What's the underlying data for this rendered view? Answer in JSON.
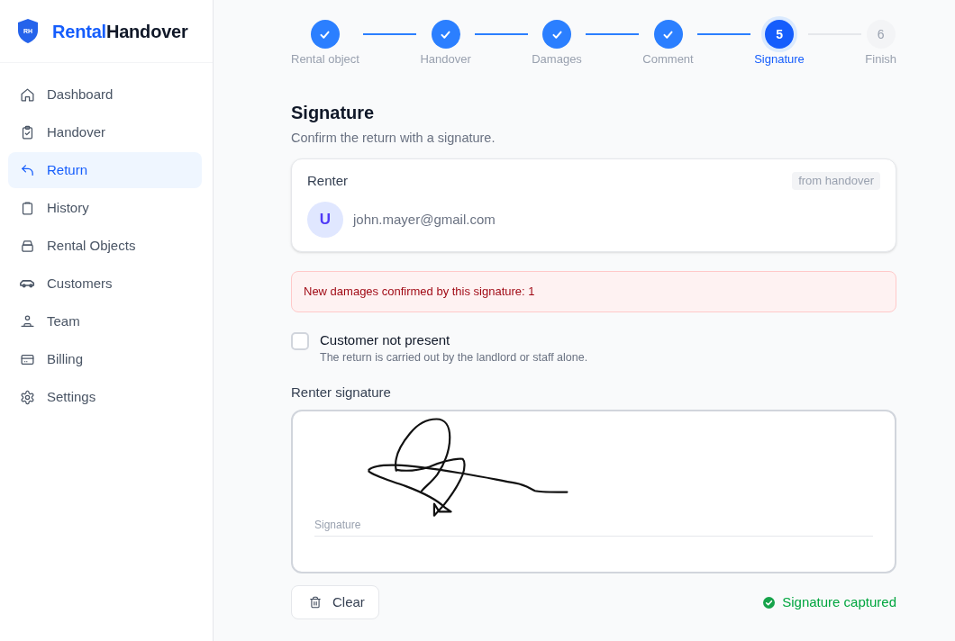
{
  "sidebar": {
    "logo": {
      "initials": "RH",
      "name_accent": "Rental",
      "name_rest": "Handover"
    },
    "items": [
      {
        "label": "Dashboard",
        "selected": false
      },
      {
        "label": "Handover",
        "selected": false
      },
      {
        "label": "Return",
        "selected": true
      },
      {
        "label": "History",
        "selected": false
      },
      {
        "label": "Rental Objects",
        "selected": false
      },
      {
        "label": "Customers",
        "selected": false
      },
      {
        "label": "Team",
        "selected": false
      },
      {
        "label": "Billing",
        "selected": false
      },
      {
        "label": "Settings",
        "selected": false
      }
    ]
  },
  "stepper": {
    "steps": [
      {
        "label": "Rental object",
        "done": true,
        "selected": false
      },
      {
        "label": "Handover",
        "done": true,
        "selected": false
      },
      {
        "label": "Damages",
        "done": true,
        "selected": false
      },
      {
        "label": "Comment",
        "done": true,
        "selected": false
      },
      {
        "label": "Signature",
        "done": false,
        "selected": true,
        "number": "5"
      },
      {
        "label": "Finish",
        "done": false,
        "selected": false,
        "number": "6"
      }
    ]
  },
  "page": {
    "title": "Signature",
    "subtitle": "Confirm the return with a signature."
  },
  "renter_card": {
    "title": "Renter",
    "badge": "from handover",
    "avatar": "U",
    "email": "john.mayer@gmail.com"
  },
  "alert": {
    "text": "New damages confirmed by this signature: 1"
  },
  "customer_not_present": {
    "label": "Customer not present",
    "description": "The return is carried out by the landlord or staff alone.",
    "checked": false
  },
  "signature": {
    "label": "Renter signature",
    "placeholder": "Signature",
    "clear_button": "Clear",
    "status": {
      "text": "Signature captured",
      "captured": true
    }
  }
}
